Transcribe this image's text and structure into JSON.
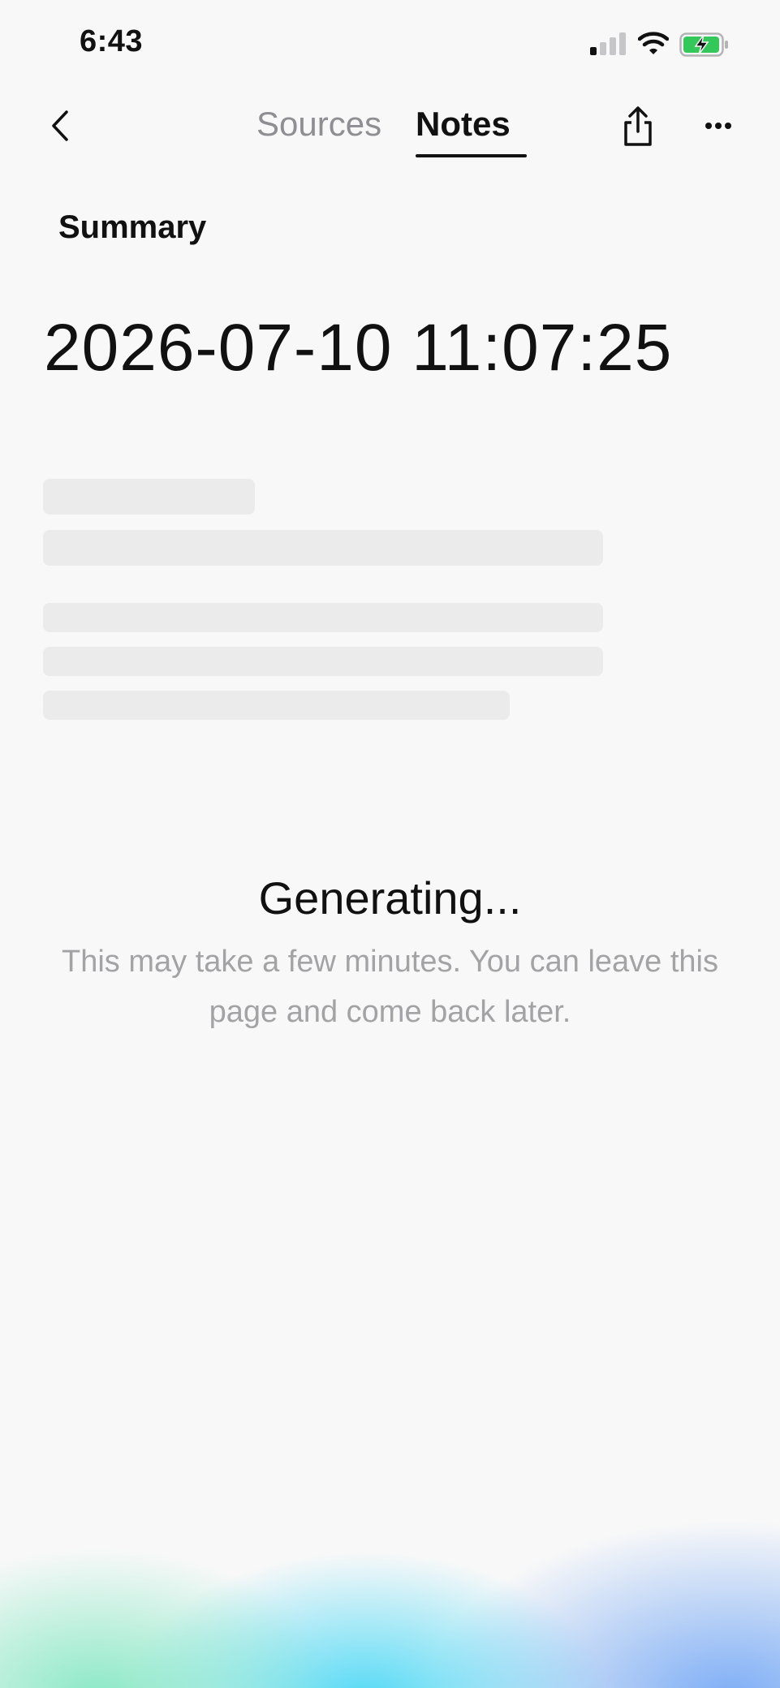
{
  "status_bar": {
    "time": "6:43",
    "battery_color": "#34c759"
  },
  "nav": {
    "tabs": [
      {
        "label": "Sources",
        "active": false
      },
      {
        "label": "Notes",
        "active": true
      }
    ],
    "icons": [
      "chevron-left-icon",
      "share-icon",
      "ellipsis-icon"
    ]
  },
  "note": {
    "section_label": "Summary",
    "title": "2026-07-10 11:07:25"
  },
  "generating": {
    "title": "Generating...",
    "message": "This may take a few minutes. You can leave this page and come back later."
  }
}
